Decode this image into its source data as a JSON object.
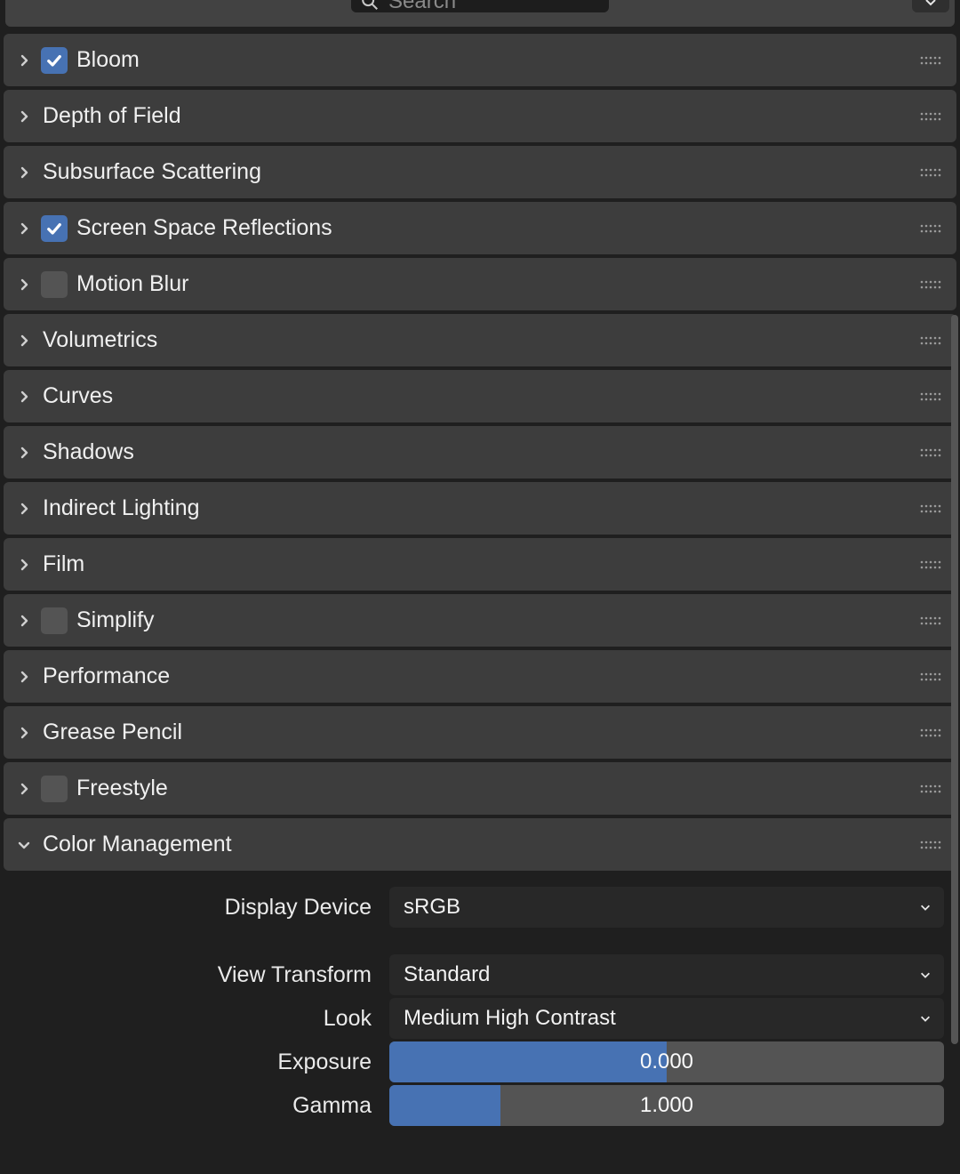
{
  "search": {
    "placeholder": "Search"
  },
  "panels": [
    {
      "label": "Bloom",
      "has_checkbox": true,
      "checked": true,
      "expanded": false
    },
    {
      "label": "Depth of Field",
      "has_checkbox": false,
      "expanded": false
    },
    {
      "label": "Subsurface Scattering",
      "has_checkbox": false,
      "expanded": false
    },
    {
      "label": "Screen Space Reflections",
      "has_checkbox": true,
      "checked": true,
      "expanded": false
    },
    {
      "label": "Motion Blur",
      "has_checkbox": true,
      "checked": false,
      "expanded": false
    },
    {
      "label": "Volumetrics",
      "has_checkbox": false,
      "expanded": false
    },
    {
      "label": "Curves",
      "has_checkbox": false,
      "expanded": false
    },
    {
      "label": "Shadows",
      "has_checkbox": false,
      "expanded": false
    },
    {
      "label": "Indirect Lighting",
      "has_checkbox": false,
      "expanded": false
    },
    {
      "label": "Film",
      "has_checkbox": false,
      "expanded": false
    },
    {
      "label": "Simplify",
      "has_checkbox": true,
      "checked": false,
      "expanded": false
    },
    {
      "label": "Performance",
      "has_checkbox": false,
      "expanded": false
    },
    {
      "label": "Grease Pencil",
      "has_checkbox": false,
      "expanded": false
    },
    {
      "label": "Freestyle",
      "has_checkbox": true,
      "checked": false,
      "expanded": false
    },
    {
      "label": "Color Management",
      "has_checkbox": false,
      "expanded": true
    }
  ],
  "color_management": {
    "display_device": {
      "label": "Display Device",
      "value": "sRGB"
    },
    "view_transform": {
      "label": "View Transform",
      "value": "Standard"
    },
    "look": {
      "label": "Look",
      "value": "Medium High Contrast"
    },
    "exposure": {
      "label": "Exposure",
      "value": "0.000",
      "fill_pct": 50
    },
    "gamma": {
      "label": "Gamma",
      "value": "1.000",
      "fill_pct": 20
    }
  },
  "colors": {
    "accent": "#4772b3",
    "panel_bg": "#3d3d3d",
    "field_bg": "#545454",
    "dropdown_bg": "#282828"
  }
}
